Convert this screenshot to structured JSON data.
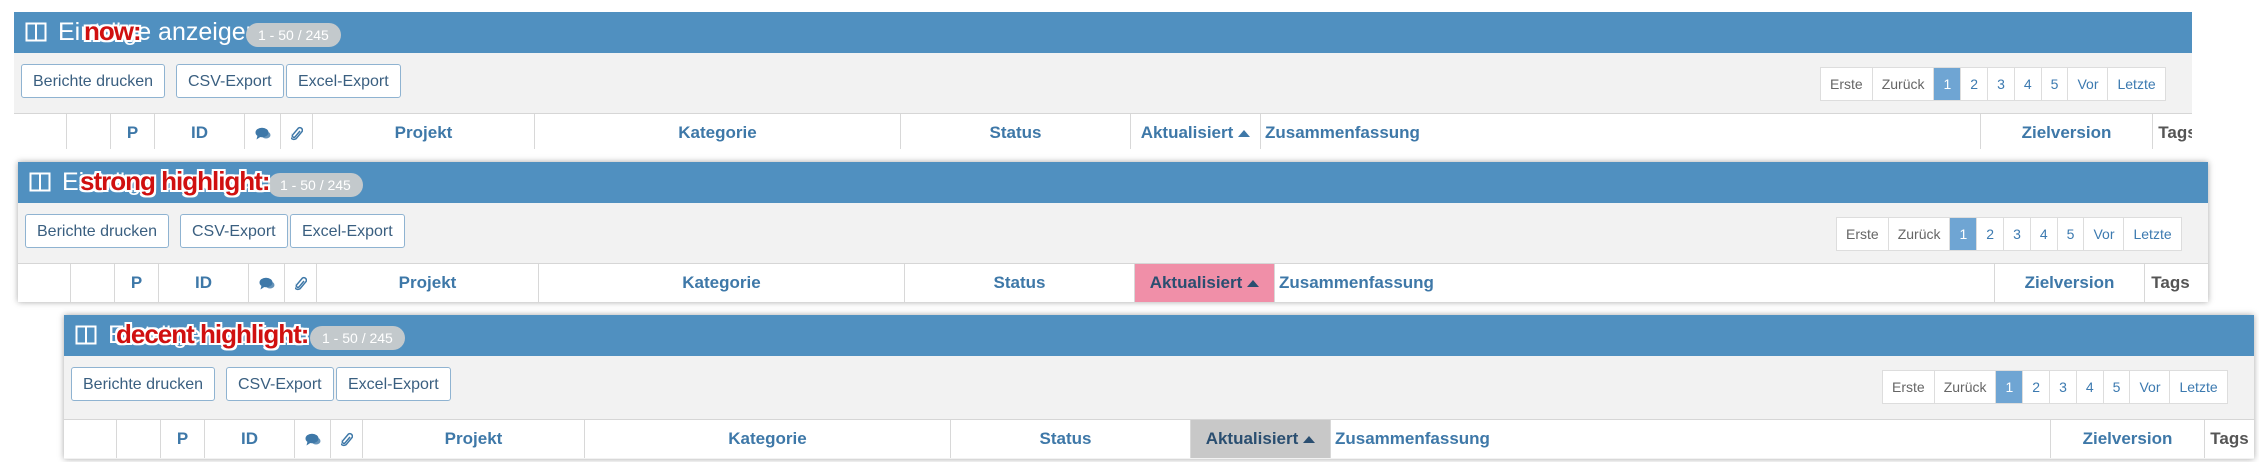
{
  "panels": [
    {
      "title": "Einträge anzeigen",
      "range": "1 - 50 / 245",
      "overlay_label": "now:",
      "highlight": "none",
      "buttons": [
        "Berichte drucken",
        "CSV-Export",
        "Excel-Export"
      ],
      "pagination": [
        "Erste",
        "Zurück",
        "1",
        "2",
        "3",
        "4",
        "5",
        "Vor",
        "Letzte"
      ],
      "pagination_active": "1",
      "columns": [
        "",
        "",
        "P",
        "ID",
        "chat-icon",
        "paperclip-icon",
        "Projekt",
        "Kategorie",
        "Status",
        "Aktualisiert",
        "Zusammenfassung",
        "Zielversion",
        "Tags"
      ]
    },
    {
      "title": "Einträge anzeigen",
      "range": "1 - 50 / 245",
      "overlay_label": "strong highlight:",
      "highlight": "strong",
      "highlight_color": "#f08fa8",
      "buttons": [
        "Berichte drucken",
        "CSV-Export",
        "Excel-Export"
      ],
      "pagination": [
        "Erste",
        "Zurück",
        "1",
        "2",
        "3",
        "4",
        "5",
        "Vor",
        "Letzte"
      ],
      "pagination_active": "1",
      "columns": [
        "",
        "",
        "P",
        "ID",
        "chat-icon",
        "paperclip-icon",
        "Projekt",
        "Kategorie",
        "Status",
        "Aktualisiert",
        "Zusammenfassung",
        "Zielversion",
        "Tags"
      ]
    },
    {
      "title": "Einträge anzeigen",
      "range": "1 - 50 / 245",
      "overlay_label": "decent highlight:",
      "highlight": "decent",
      "highlight_color": "#c8c8c8",
      "buttons": [
        "Berichte drucken",
        "CSV-Export",
        "Excel-Export"
      ],
      "pagination": [
        "Erste",
        "Zurück",
        "1",
        "2",
        "3",
        "4",
        "5",
        "Vor",
        "Letzte"
      ],
      "pagination_active": "1",
      "columns": [
        "",
        "",
        "P",
        "ID",
        "chat-icon",
        "paperclip-icon",
        "Projekt",
        "Kategorie",
        "Status",
        "Aktualisiert",
        "Zusammenfassung",
        "Zielversion",
        "Tags"
      ]
    }
  ],
  "colors": {
    "title_bar": "#5090c0",
    "link": "#3e78a8",
    "overlay_label": "#d01010",
    "pagination_active": "#6fa5d3"
  }
}
